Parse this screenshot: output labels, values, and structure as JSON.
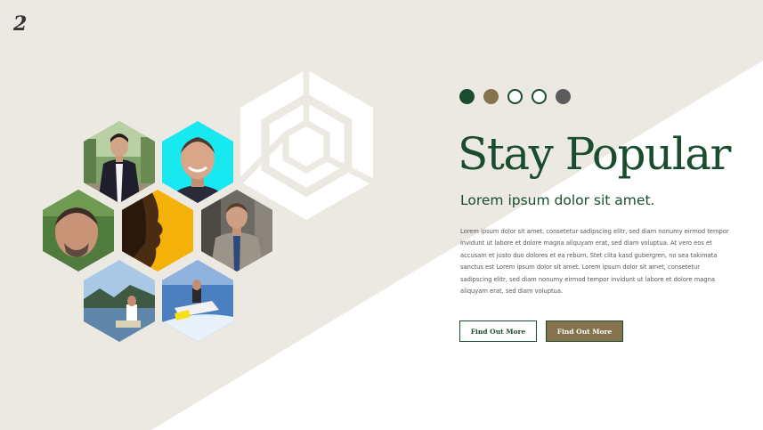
{
  "slide": {
    "page_number": "2",
    "title": "Stay Popular",
    "subtitle": "Lorem ipsum dolor sit amet.",
    "body": "Lorem ipsum dolor sit amet, consetetur sadipscing elitr, sed diam nonumy eirmod tempor invidunt ut labore et dolore magna aliquyam erat, sed diam voluptua. At vero eos et accusam et justo duo dolores et ea rebum. Stet clita kasd gubergren, no sea takimata sanctus est Lorem ipsum dolor sit amet. Lorem ipsum dolor sit amet, consetetur sadipscing elitr, sed diam nonumy eirmod tempor invidunt ut labore et dolore magna aliquyam erat, sed diam voluptua.",
    "buttons": {
      "primary_label": "Find Out More",
      "secondary_label": "Find Out More"
    }
  },
  "color_palette": [
    "#1a4d2e",
    "#85734e",
    "#ffffff",
    "#ffffff",
    "#5c5c5c"
  ],
  "colors": {
    "accent_green": "#1a4d2e",
    "accent_gold": "#85734e",
    "background": "#ece8e2"
  },
  "icons": {
    "logo": "hexagon-logo-icon"
  }
}
